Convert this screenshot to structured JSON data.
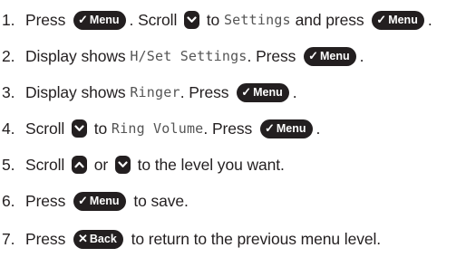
{
  "buttons": {
    "menu_label": "Menu",
    "back_label": "Back",
    "check_glyph": "✓",
    "cross_glyph": "✕"
  },
  "steps": [
    {
      "num": "1.",
      "a": "Press",
      "b": ". Scroll",
      "c": "to",
      "d": "Settings",
      "e": "and press",
      "f": "."
    },
    {
      "num": "2.",
      "a": "Display shows",
      "b": "H/Set Settings",
      "c": ". Press",
      "d": "."
    },
    {
      "num": "3.",
      "a": "Display shows",
      "b": "Ringer",
      "c": ". Press",
      "d": "."
    },
    {
      "num": "4.",
      "a": "Scroll",
      "b": "to",
      "c": "Ring Volume",
      "d": ". Press",
      "e": "."
    },
    {
      "num": "5.",
      "a": "Scroll",
      "b": "or",
      "c": "to the level you want."
    },
    {
      "num": "6.",
      "a": "Press",
      "b": "to save."
    },
    {
      "num": "7.",
      "a": "Press",
      "b": "to return to the previous menu level."
    }
  ]
}
